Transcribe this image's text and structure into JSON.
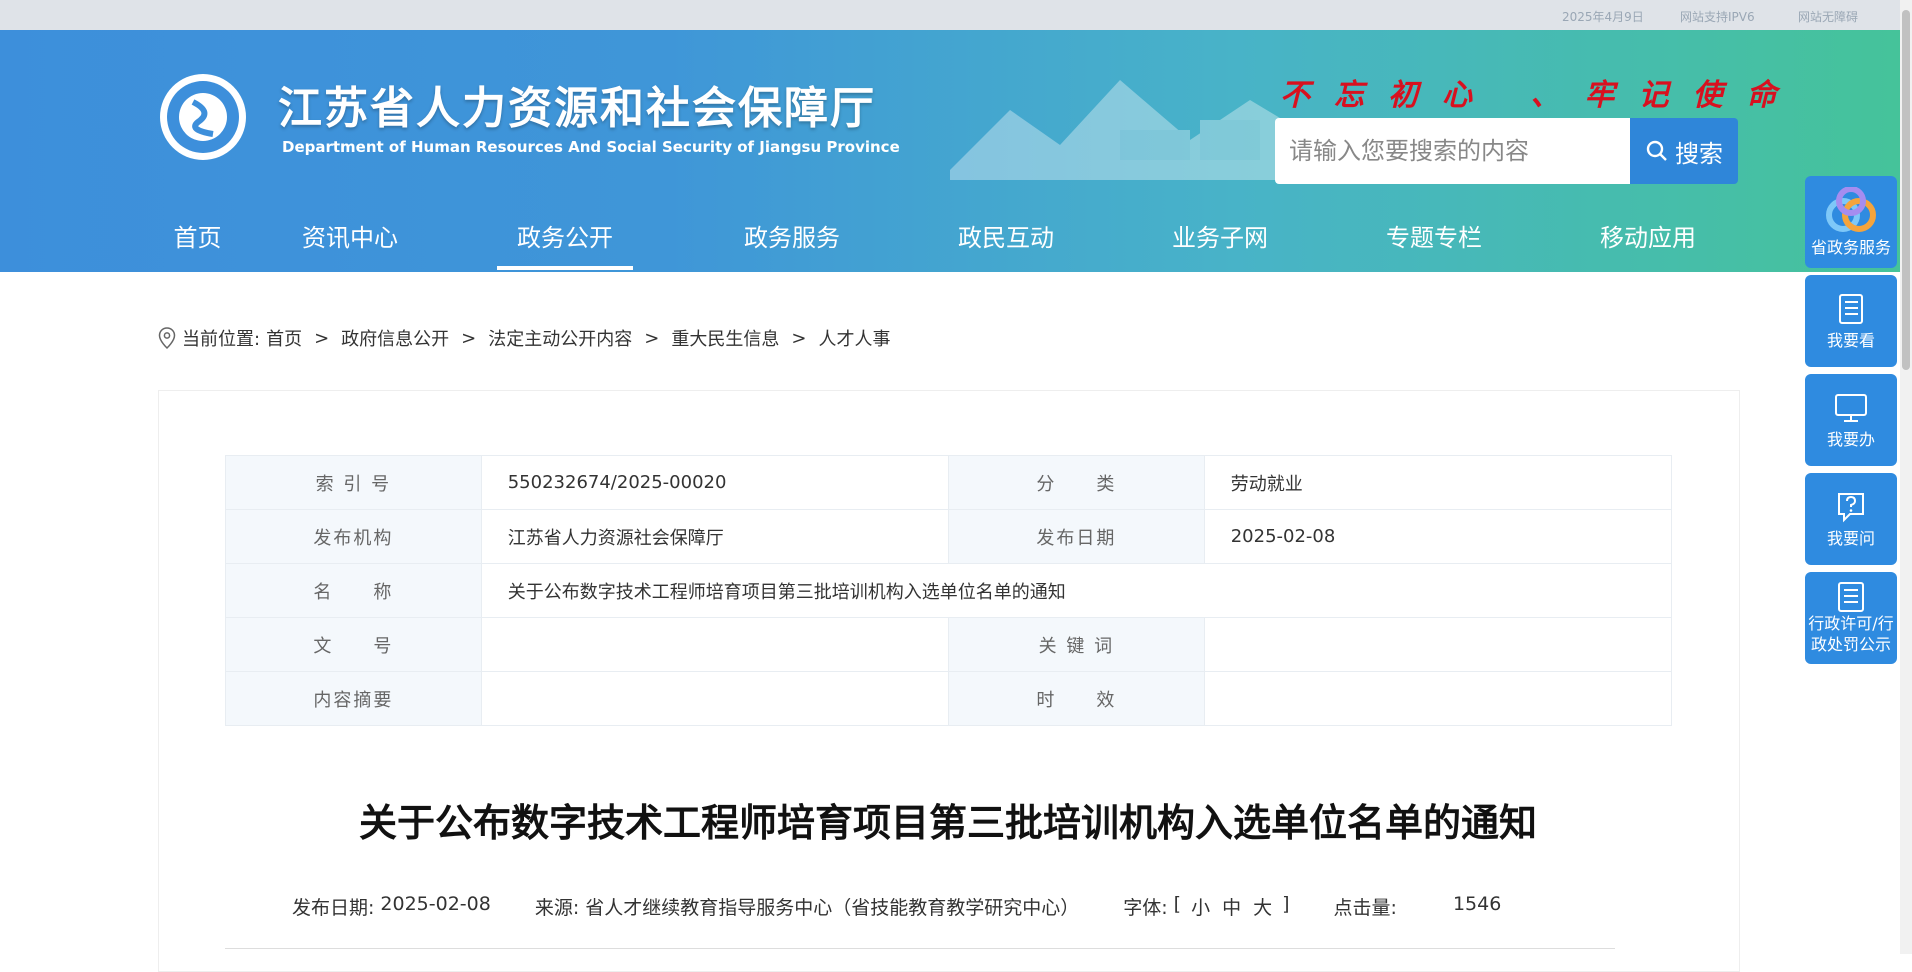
{
  "topbar": {
    "date": "2025年4月9日",
    "ipv6": "网站支持IPV6",
    "accessibility": "网站无障碍"
  },
  "header": {
    "title": "江苏省人力资源和社会保障厅",
    "subtitle": "Department of Human Resources And Social Security of Jiangsu Province",
    "slogan": "不忘初心 、牢记使命",
    "search_placeholder": "请输入您要搜索的内容",
    "search_button": "搜索"
  },
  "nav": {
    "items": [
      {
        "label": "首页"
      },
      {
        "label": "资讯中心"
      },
      {
        "label": "政务公开"
      },
      {
        "label": "政务服务"
      },
      {
        "label": "政民互动"
      },
      {
        "label": "业务子网"
      },
      {
        "label": "专题专栏"
      },
      {
        "label": "移动应用"
      }
    ],
    "active_index": 2
  },
  "breadcrumb": {
    "prefix": "当前位置:",
    "items": [
      "首页",
      "政府信息公开",
      "法定主动公开内容",
      "重大民生信息",
      "人才人事"
    ],
    "separator": ">"
  },
  "meta": {
    "index_label": "索 引 号",
    "index_value": "550232674/2025-00020",
    "category_label": "分　　类",
    "category_value": "劳动就业",
    "publisher_label": "发布机构",
    "publisher_value": "江苏省人力资源社会保障厅",
    "date_label": "发布日期",
    "date_value": "2025-02-08",
    "name_label": "名　　称",
    "name_value": "关于公布数字技术工程师培育项目第三批培训机构入选单位名单的通知",
    "docno_label": "文　　号",
    "docno_value": "",
    "keywords_label": "关 键 词",
    "keywords_value": "",
    "summary_label": "内容摘要",
    "summary_value": "",
    "validity_label": "时　　效",
    "validity_value": ""
  },
  "article": {
    "title": "关于公布数字技术工程师培育项目第三批培训机构入选单位名单的通知",
    "date_label": "发布日期:",
    "date_value": "2025-02-08",
    "source_label": "来源:",
    "source_value": "省人才继续教育指导服务中心（省技能教育教学研究中心）",
    "font_label": "字体:",
    "font_open": "[",
    "font_small": "小",
    "font_medium": "中",
    "font_large": "大",
    "font_close": "]",
    "views_label": "点击量:",
    "views_value": "1546"
  },
  "float_bar": {
    "gov_service": "省政务服务",
    "view": "我要看",
    "do": "我要办",
    "ask": "我要问",
    "license_line1": "行政许可/行",
    "license_line2": "政处罚公示"
  },
  "colors": {
    "header_start": "#3d8fdb",
    "header_end": "#45c39a",
    "slogan": "#d8101f",
    "button_blue": "#2f86d9"
  }
}
